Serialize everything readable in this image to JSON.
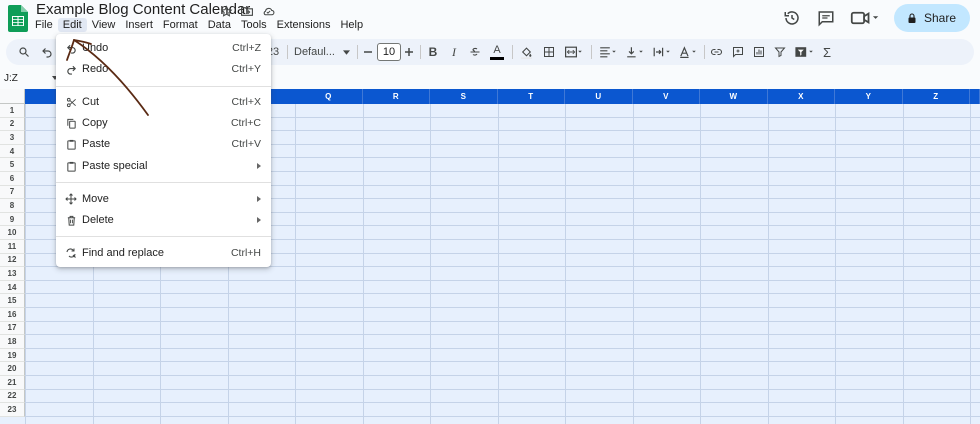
{
  "document": {
    "title": "Example Blog Content Calendar"
  },
  "menubar": {
    "items": [
      "File",
      "Edit",
      "View",
      "Insert",
      "Format",
      "Data",
      "Tools",
      "Extensions",
      "Help"
    ]
  },
  "header": {
    "share_label": "Share"
  },
  "toolbar": {
    "font_name": "Defaul...",
    "font_size": "10",
    "partial_format": "23",
    "bold": "B",
    "italic": "I",
    "sum": "Σ",
    "text_color": "A"
  },
  "namebox": {
    "value": "J:Z"
  },
  "grid": {
    "columns": [
      "Q",
      "R",
      "S",
      "T",
      "U",
      "V",
      "W",
      "X",
      "Y",
      "Z"
    ],
    "rows": [
      "1",
      "2",
      "3",
      "4",
      "5",
      "6",
      "7",
      "8",
      "9",
      "10",
      "11",
      "12",
      "13",
      "14",
      "15",
      "16",
      "17",
      "18",
      "19",
      "20",
      "21",
      "22",
      "23"
    ]
  },
  "edit_menu": {
    "items": [
      {
        "label": "Undo",
        "shortcut": "Ctrl+Z",
        "icon": "undo-icon"
      },
      {
        "label": "Redo",
        "shortcut": "Ctrl+Y",
        "icon": "redo-icon"
      },
      {
        "label": "Cut",
        "shortcut": "Ctrl+X",
        "icon": "scissors-icon"
      },
      {
        "label": "Copy",
        "shortcut": "Ctrl+C",
        "icon": "copy-icon"
      },
      {
        "label": "Paste",
        "shortcut": "Ctrl+V",
        "icon": "clipboard-icon"
      },
      {
        "label": "Paste special",
        "shortcut": "",
        "icon": "clipboard-icon"
      },
      {
        "label": "Move",
        "shortcut": "",
        "icon": "move-arrows-icon"
      },
      {
        "label": "Delete",
        "shortcut": "",
        "icon": "trash-icon"
      },
      {
        "label": "Find and replace",
        "shortcut": "Ctrl+H",
        "icon": "find-replace-icon"
      }
    ]
  },
  "colors": {
    "accent": "#0b57d0",
    "selection": "#e7f0fd",
    "share_bg": "#c2e7ff",
    "toolbar_bg": "#edf2fa",
    "annotation": "#5a2a14"
  }
}
